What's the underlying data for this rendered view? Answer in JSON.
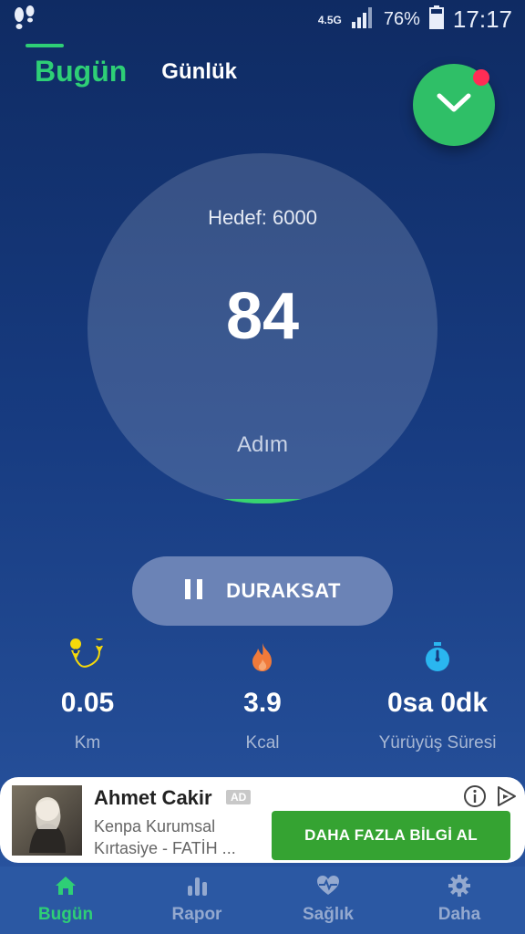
{
  "status": {
    "network": "4.5G",
    "battery": "76%",
    "time": "17:17"
  },
  "tabs": {
    "today": "Bugün",
    "daily": "Günlük"
  },
  "progress": {
    "goal_text": "Hedef: 6000",
    "steps": "84",
    "unit": "Adım",
    "fraction": 0.014
  },
  "pause_button": {
    "label": "DURAKSAT"
  },
  "stats": [
    {
      "value": "0.05",
      "label": "Km",
      "icon": "route-pin-icon"
    },
    {
      "value": "3.9",
      "label": "Kcal",
      "icon": "flame-icon"
    },
    {
      "value": "0sa 0dk",
      "label": "Yürüyüş Süresi",
      "icon": "stopwatch-icon"
    }
  ],
  "ad": {
    "title": "Ahmet Cakir",
    "badge": "AD",
    "line1": "Kenpa Kurumsal",
    "line2": "Kırtasiye - FATİH ...",
    "cta": "DAHA FAZLA BİLGİ AL"
  },
  "nav": [
    {
      "label": "Bugün",
      "icon": "home-icon",
      "active": true
    },
    {
      "label": "Rapor",
      "icon": "bar-chart-icon",
      "active": false
    },
    {
      "label": "Sağlık",
      "icon": "heart-pulse-icon",
      "active": false
    },
    {
      "label": "Daha",
      "icon": "gear-icon",
      "active": false
    }
  ],
  "colors": {
    "accent": "#2ecf76",
    "background_top": "#0f2b63",
    "ad_button": "#35a332",
    "notification_dot": "#ff2d55"
  }
}
